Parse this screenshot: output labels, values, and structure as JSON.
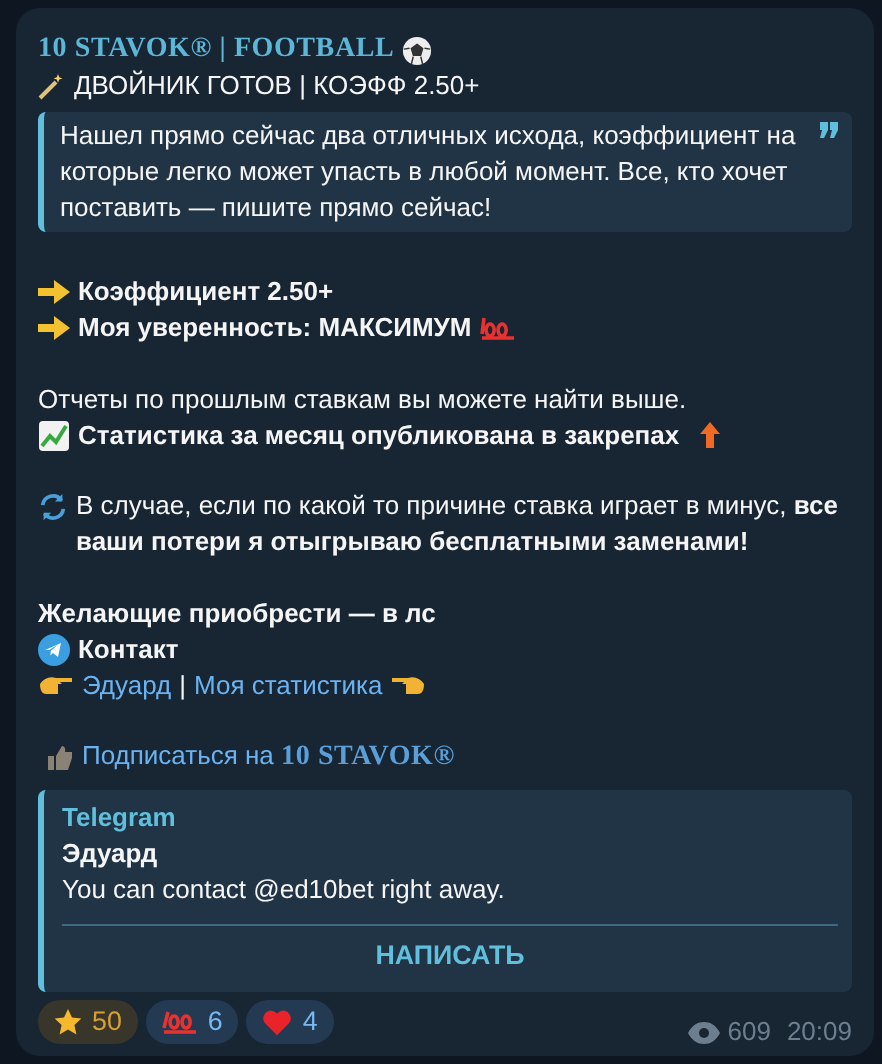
{
  "channel_title": "10 STAVOK® | FOOTBALL",
  "headline": "ДВОЙНИК ГОТОВ | КОЭФФ 2.50+",
  "quote": "Нашел прямо сейчас два отличных исхода, коэффициент на которые легко может упасть в любой момент. Все, кто хочет поставить — пишите прямо сейчас!",
  "bullets": [
    {
      "text": "Коэффициент 2.50+"
    },
    {
      "text": "Моя уверенность: МАКСИМУМ"
    }
  ],
  "reports": {
    "text": "Отчеты по прошлым ставкам вы можете найти выше.",
    "pinned": "Статистика за месяц опубликована в закрепах"
  },
  "refund": "В случае, если по какой то причине ставка играет в минус, **все ваши потери я отыгрываю бесплатными заменами!**",
  "contact_heading": "Желающие приобрести — в лс",
  "contact_label": "Контакт",
  "links": [
    "Эдуард",
    "Моя статистика"
  ],
  "link_separator": "|",
  "subscribe": {
    "text": "Подписаться на",
    "channel": "10 STAVOK®"
  },
  "preview": {
    "site": "Telegram",
    "title": "Эдуард",
    "description": "You can contact @ed10bet right away.",
    "button": "НАПИСАТЬ"
  },
  "reactions": [
    {
      "kind": "star",
      "count": "50"
    },
    {
      "kind": "hundred",
      "count": "6"
    },
    {
      "kind": "heart",
      "count": "4"
    }
  ],
  "views": "609",
  "time": "20:09"
}
